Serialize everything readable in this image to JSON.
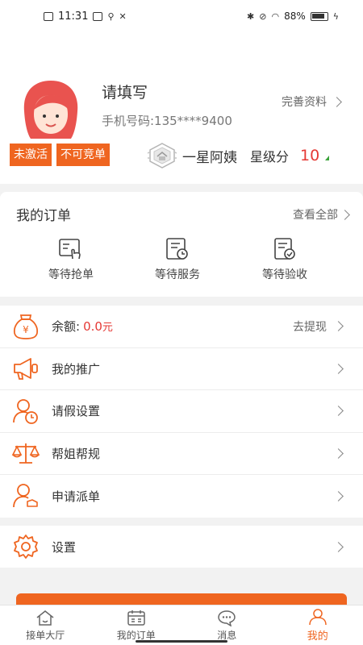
{
  "status_bar": {
    "time": "11:31",
    "battery": "88%"
  },
  "profile": {
    "name": "请填写",
    "phone": "手机号码:135****9400",
    "complete_link": "完善资料",
    "badges": [
      "未激活",
      "不可竞单"
    ],
    "level_name": "一星阿姨",
    "score_label": "星级分",
    "score_value": "10"
  },
  "orders": {
    "title": "我的订单",
    "view_all": "查看全部",
    "items": [
      {
        "label": "等待抢单",
        "icon": "hand-tap-icon"
      },
      {
        "label": "等待服务",
        "icon": "document-clock-icon"
      },
      {
        "label": "等待验收",
        "icon": "document-check-icon"
      }
    ]
  },
  "menu": {
    "balance_label": "余额:",
    "balance_value": "0.0",
    "balance_unit": "元",
    "withdraw": "去提现",
    "promotion": "我的推广",
    "leave": "请假设置",
    "rules": "帮姐帮规",
    "dispatch": "申请派单",
    "settings": "设置"
  },
  "tabs": [
    {
      "label": "接单大厅",
      "icon": "home-icon",
      "active": false
    },
    {
      "label": "我的订单",
      "icon": "calendar-icon",
      "active": false
    },
    {
      "label": "消息",
      "icon": "chat-icon",
      "active": false
    },
    {
      "label": "我的",
      "icon": "user-icon",
      "active": true
    }
  ],
  "colors": {
    "accent": "#ef6520",
    "price": "#e53935"
  }
}
